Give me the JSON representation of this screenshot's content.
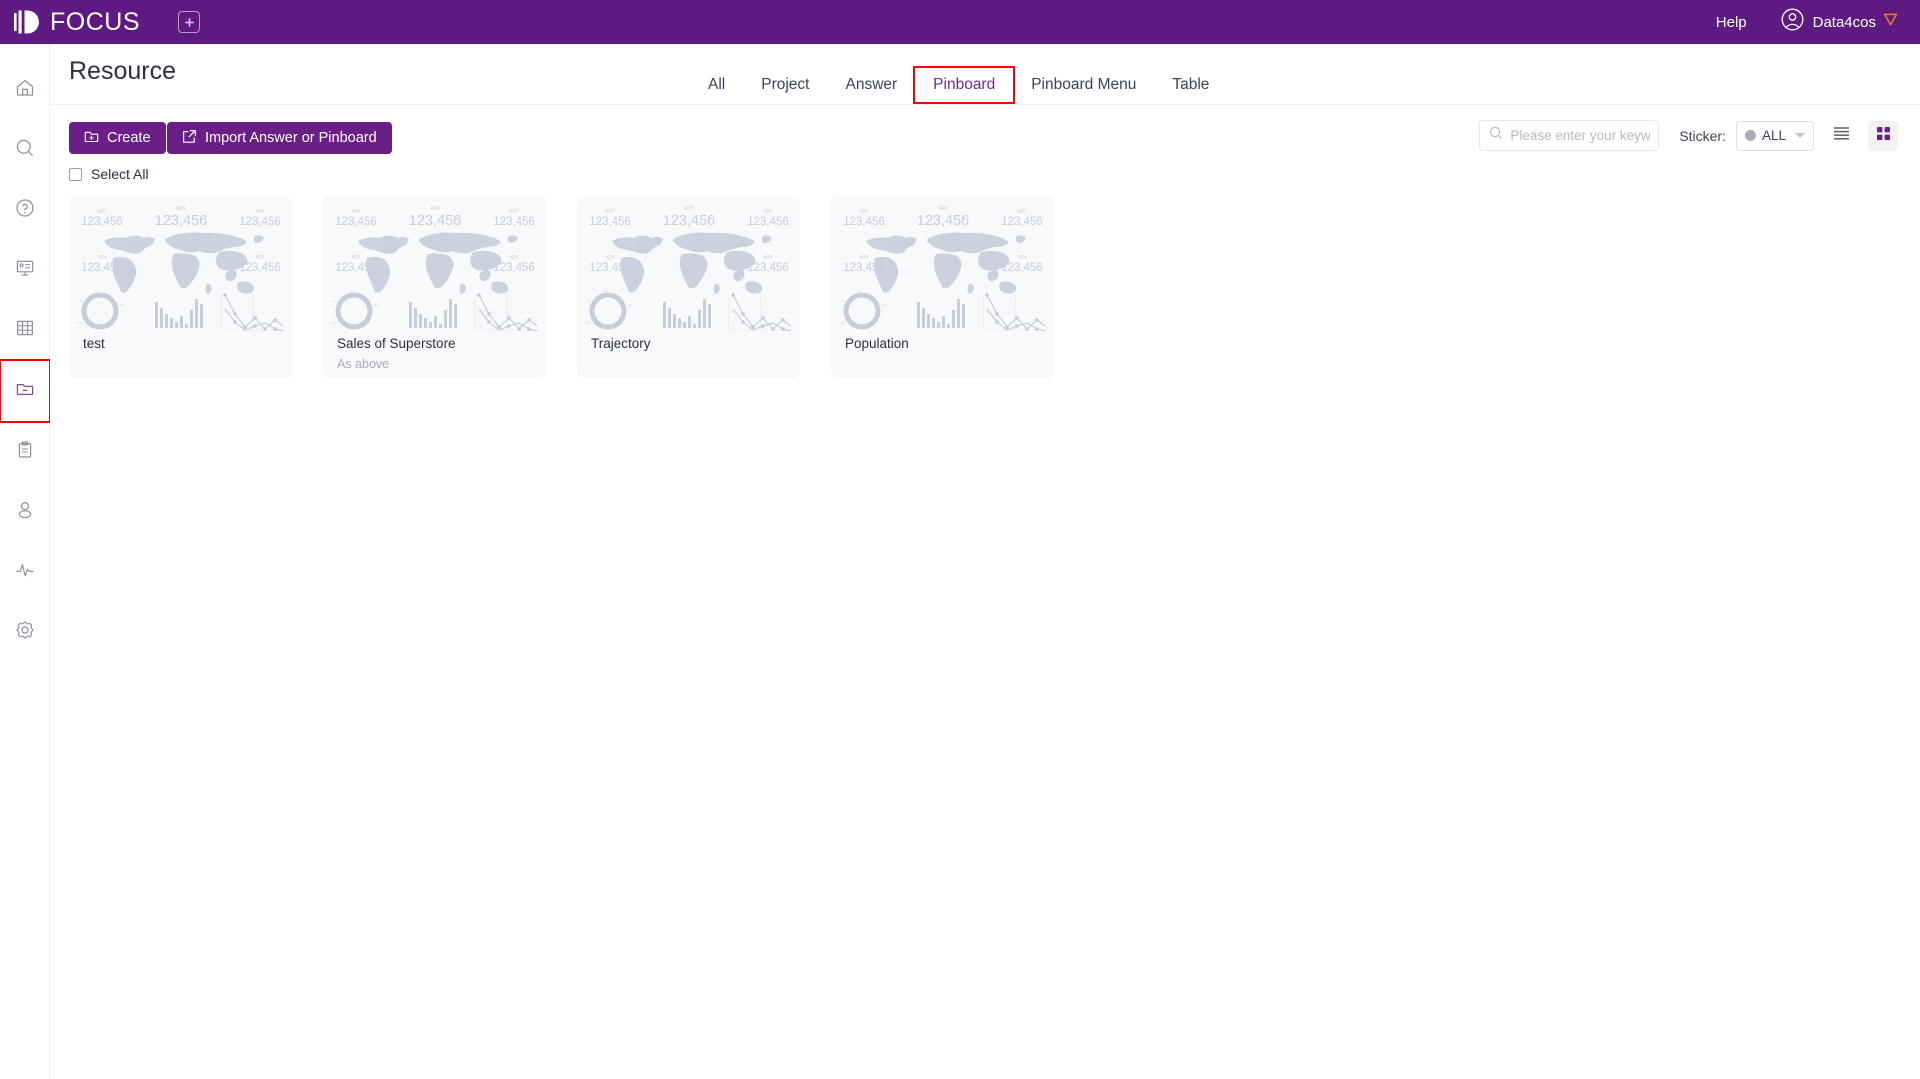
{
  "colors": {
    "brand_purple": "#5e1a80",
    "button_purple": "#6b1f86",
    "accent_purple": "#6b2d91",
    "highlight_red": "#ff0000",
    "card_bg": "#f8f9fb",
    "thumb_gray": "#ccd2de"
  },
  "topbar": {
    "logo_text": "FOCUS",
    "add_tab_icon": "plus-square-icon",
    "help_label": "Help",
    "username": "Data4cos",
    "avatar_icon": "user-circle-icon",
    "badge_icon": "shield-icon"
  },
  "sidebar": {
    "items": [
      {
        "name": "home",
        "icon": "home-icon",
        "active": false
      },
      {
        "name": "search",
        "icon": "search-icon",
        "active": false
      },
      {
        "name": "help",
        "icon": "question-circle-icon",
        "active": false
      },
      {
        "name": "presentation",
        "icon": "presentation-icon",
        "active": false
      },
      {
        "name": "table",
        "icon": "grid-table-icon",
        "active": false
      },
      {
        "name": "resource",
        "icon": "folder-minus-icon",
        "active": true
      },
      {
        "name": "clipboard",
        "icon": "clipboard-icon",
        "active": false
      },
      {
        "name": "user",
        "icon": "person-icon",
        "active": false
      },
      {
        "name": "monitor",
        "icon": "pulse-icon",
        "active": false
      },
      {
        "name": "settings",
        "icon": "gear-icon",
        "active": false
      }
    ]
  },
  "header": {
    "title": "Resource"
  },
  "tabs": [
    {
      "label": "All",
      "active": false,
      "boxed": false
    },
    {
      "label": "Project",
      "active": false,
      "boxed": false
    },
    {
      "label": "Answer",
      "active": false,
      "boxed": false
    },
    {
      "label": "Pinboard",
      "active": true,
      "boxed": true
    },
    {
      "label": "Pinboard Menu",
      "active": false,
      "boxed": false
    },
    {
      "label": "Table",
      "active": false,
      "boxed": false
    }
  ],
  "toolbar": {
    "create_label": "Create",
    "create_icon": "folder-plus-icon",
    "import_label": "Import Answer or Pinboard",
    "import_icon": "import-icon",
    "search_placeholder": "Please enter your keywo",
    "search_value": "",
    "search_icon": "search-icon",
    "sticker_label": "Sticker:",
    "sticker_value": "ALL",
    "list_view_icon": "list-view-icon",
    "grid_view_icon": "grid-view-icon",
    "active_view": "grid"
  },
  "select_all": {
    "label": "Select All",
    "checked": false
  },
  "cards": [
    {
      "title": "test",
      "subtitle": "",
      "thumb": "dashboard-placeholder-thumbnail"
    },
    {
      "title": "Sales of Superstore",
      "subtitle": "As above",
      "thumb": "dashboard-placeholder-thumbnail"
    },
    {
      "title": "Trajectory",
      "subtitle": "",
      "thumb": "dashboard-placeholder-thumbnail"
    },
    {
      "title": "Population",
      "subtitle": "",
      "thumb": "dashboard-placeholder-thumbnail"
    }
  ],
  "thumbnail": {
    "kpi_label": "KPI",
    "kpi_value": "123,456",
    "kpi_count": 5
  }
}
